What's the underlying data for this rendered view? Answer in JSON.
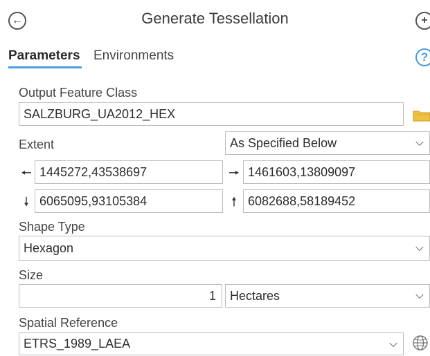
{
  "header": {
    "title": "Generate Tessellation"
  },
  "tabs": {
    "parameters": "Parameters",
    "environments": "Environments",
    "help_symbol": "?"
  },
  "output_feature_class": {
    "label": "Output Feature Class",
    "value": "SALZBURG_UA2012_HEX"
  },
  "extent": {
    "label": "Extent",
    "selected": "As Specified Below",
    "left": "1445272,43538697",
    "right": "1461603,13809097",
    "bottom": "6065095,93105384",
    "top": "6082688,58189452"
  },
  "shape_type": {
    "label": "Shape Type",
    "value": "Hexagon"
  },
  "size": {
    "label": "Size",
    "value": "1",
    "unit": "Hectares"
  },
  "spatial_reference": {
    "label": "Spatial Reference",
    "value": "ETRS_1989_LAEA"
  },
  "icons": {
    "back": "back-arrow-icon",
    "add": "plus-icon",
    "help": "help-icon",
    "folder": "folder-icon",
    "globe": "globe-icon",
    "left_arrow": "arrow-left-icon",
    "right_arrow": "arrow-right-icon",
    "down_arrow": "arrow-down-icon",
    "up_arrow": "arrow-up-icon"
  },
  "colors": {
    "accent": "#4a9be0",
    "folder": "#f0c040"
  }
}
